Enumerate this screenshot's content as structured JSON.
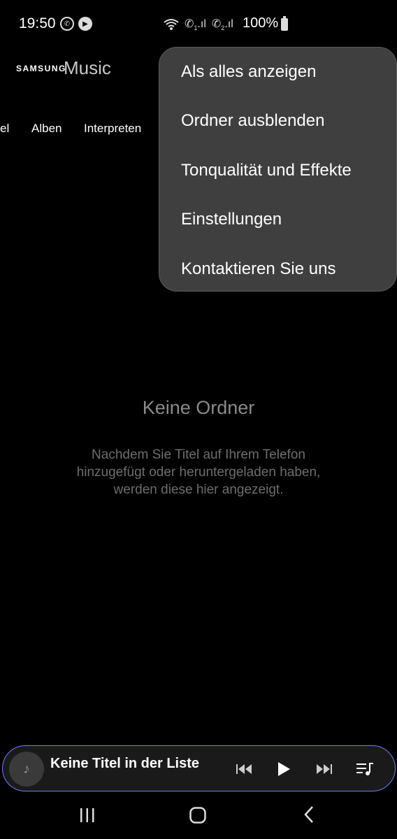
{
  "status_bar": {
    "time": "19:50",
    "battery": "100%",
    "icons": [
      "whatsapp-icon",
      "play-notification-icon",
      "wifi-call-icon",
      "sim1-call-icon",
      "sim2-call-icon",
      "battery-icon"
    ],
    "sim1_label": "1",
    "sim2_label": "2"
  },
  "header": {
    "brand_samsung": "SAMSUNG",
    "brand_music": "Music"
  },
  "tabs": {
    "partial": "el",
    "albums": "Alben",
    "artists": "Interpreten"
  },
  "menu": {
    "items": [
      "Als alles anzeigen",
      "Ordner ausblenden",
      "Tonqualität und Effekte",
      "Einstellungen",
      "Kontaktieren Sie uns"
    ]
  },
  "empty_state": {
    "title": "Keine Ordner",
    "description": "Nachdem Sie Titel auf Ihrem Telefon hinzugefügt oder heruntergeladen haben, werden diese hier angezeigt."
  },
  "player": {
    "title": "Keine Titel in der Liste",
    "accent_color": "#6f7bff"
  }
}
